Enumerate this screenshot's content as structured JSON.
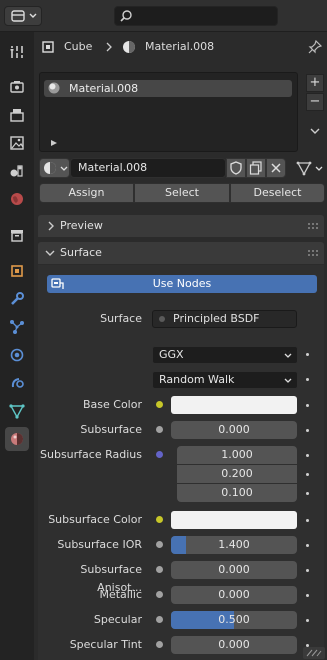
{
  "header": {
    "search_placeholder": ""
  },
  "breadcrumb": {
    "object": "Cube",
    "material": "Material.008"
  },
  "slots": {
    "items": [
      {
        "label": "Material.008"
      }
    ]
  },
  "datablock": {
    "name": "Material.008"
  },
  "actions": {
    "assign": "Assign",
    "select": "Select",
    "deselect": "Deselect"
  },
  "sections": {
    "preview": "Preview",
    "surface": "Surface"
  },
  "surface": {
    "use_nodes": "Use Nodes",
    "surface_label": "Surface",
    "shader": "Principled BSDF",
    "distribution": "GGX",
    "subsurface_method": "Random Walk",
    "props": {
      "base_color": {
        "label": "Base Color",
        "color": "#f2f2f2"
      },
      "subsurface": {
        "label": "Subsurface",
        "value": "0.000",
        "fraction": 0
      },
      "subsurface_radius": {
        "label": "Subsurface Radius",
        "values": [
          "1.000",
          "0.200",
          "0.100"
        ]
      },
      "subsurface_color": {
        "label": "Subsurface Color",
        "color": "#f2f2f2"
      },
      "subsurface_ior": {
        "label": "Subsurface IOR",
        "value": "1.400",
        "fraction": 0.12
      },
      "subsurface_anisotropy": {
        "label": "Subsurface Anisot...",
        "value": "0.000",
        "fraction": 0
      },
      "metallic": {
        "label": "Metallic",
        "value": "0.000",
        "fraction": 0
      },
      "specular": {
        "label": "Specular",
        "value": "0.500",
        "fraction": 0.5
      },
      "specular_tint": {
        "label": "Specular Tint",
        "value": "0.000",
        "fraction": 0
      }
    }
  },
  "colors": {
    "accent": "#4772b3",
    "color_socket": "#c7c729",
    "float_socket": "#a1a1a1",
    "vector_socket": "#6363c7",
    "material_tab": "#c87a7a"
  }
}
